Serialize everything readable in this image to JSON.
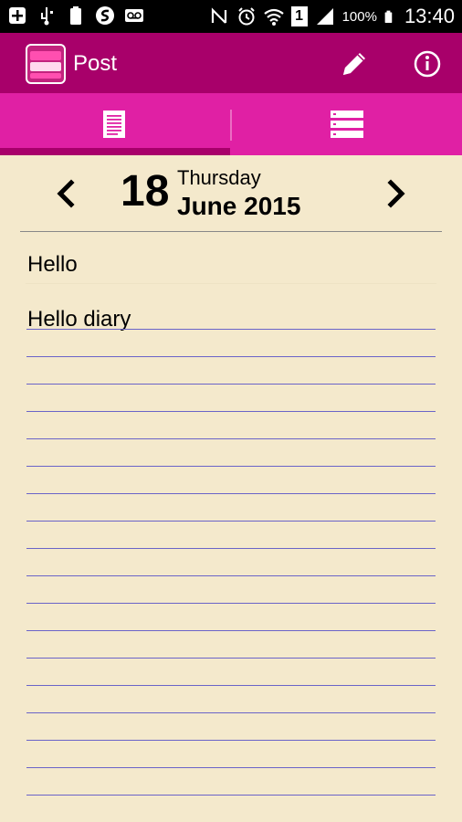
{
  "status_bar": {
    "icons_left": [
      "add-box-icon",
      "usb-icon",
      "battery-100-icon",
      "s-logo-icon",
      "voicemail-icon"
    ],
    "icons_right": [
      "nfc-icon",
      "alarm-icon",
      "wifi-icon",
      "sim-icon",
      "signal-icon"
    ],
    "sim_label": "1",
    "battery_pct": "100%",
    "time": "13:40"
  },
  "app_bar": {
    "title": "Post",
    "logo_icon": "diary-logo-icon",
    "actions": [
      "edit-icon",
      "info-icon"
    ],
    "color": "#a8006a"
  },
  "tabs": [
    {
      "icon": "document-icon",
      "selected": true
    },
    {
      "icon": "list-icon",
      "selected": false
    }
  ],
  "tab_color": "#e020a4",
  "date_nav": {
    "day": "18",
    "weekday": "Thursday",
    "month_year": "June 2015",
    "prev_icon": "chevron-left-icon",
    "next_icon": "chevron-right-icon"
  },
  "entry": {
    "title": "Hello",
    "body": "Hello diary"
  },
  "page_color": "#f4e9cc",
  "line_color": "#6a64c8"
}
